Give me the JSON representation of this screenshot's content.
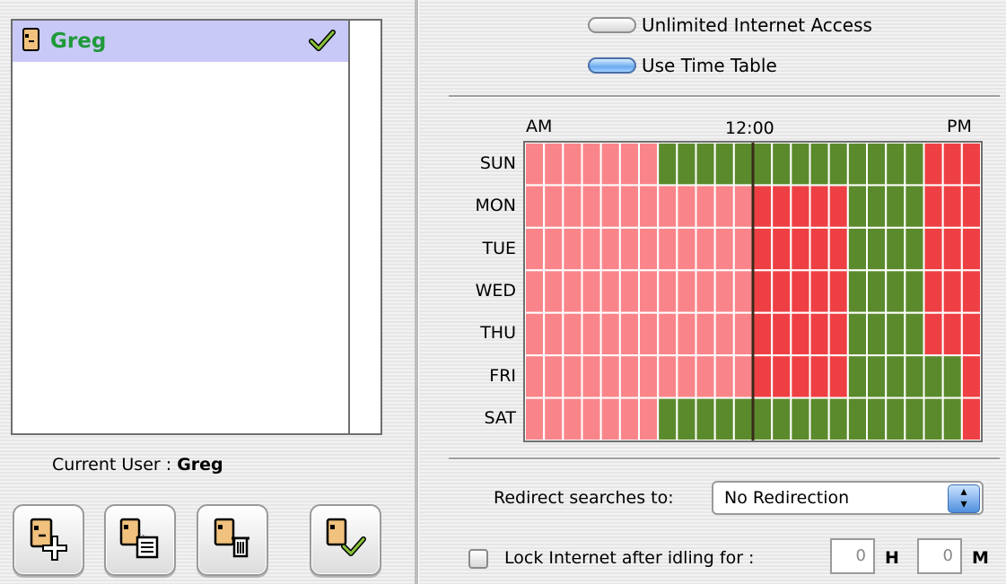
{
  "users": [
    {
      "name": "Greg",
      "selected": true,
      "checked": true
    }
  ],
  "current_user": {
    "label": "Current User :",
    "name": "Greg"
  },
  "toolbar": {
    "buttons": [
      {
        "icon": "add-user-icon"
      },
      {
        "icon": "duplicate-user-icon"
      },
      {
        "icon": "delete-user-icon"
      },
      {
        "icon": "set-current-user-icon"
      }
    ]
  },
  "access": {
    "unlimited_label": "Unlimited Internet Access",
    "timetable_label": "Use Time Table",
    "selected": "timetable"
  },
  "time_table": {
    "time_labels": {
      "start": "AM",
      "middle": "12:00",
      "end": "PM"
    },
    "days": [
      "SUN",
      "MON",
      "TUE",
      "WED",
      "THU",
      "FRI",
      "SAT"
    ],
    "slots_per_day": 24,
    "slot_unit": "hour",
    "allowed_hours": [
      [
        7,
        8,
        9,
        10,
        11,
        12,
        13,
        14,
        15,
        16,
        17,
        18,
        19,
        20
      ],
      [
        17,
        18,
        19,
        20
      ],
      [
        17,
        18,
        19,
        20
      ],
      [
        17,
        18,
        19,
        20
      ],
      [
        17,
        18,
        19,
        20
      ],
      [
        17,
        18,
        19,
        20,
        21,
        22
      ],
      [
        7,
        8,
        9,
        10,
        11,
        12,
        13,
        14,
        15,
        16,
        17,
        18,
        19,
        20,
        21,
        22
      ]
    ],
    "colors": {
      "blocked_am": "#f9858a",
      "blocked_pm": "#ee4044",
      "allowed": "#5b8a2c",
      "grid_line": "#ffffff",
      "noon_line": "#3a2a1a"
    }
  },
  "redirect": {
    "label": "Redirect searches to:",
    "value": "No Redirection"
  },
  "idle_lock": {
    "label": "Lock Internet after idling for :",
    "checked": false,
    "hours": "0",
    "hours_unit": "H",
    "minutes": "0",
    "minutes_unit": "M"
  },
  "colors": {
    "selected_row": "#c9c9f7",
    "user_name": "#1f9a3a",
    "accent_blue": "#4f8fde"
  }
}
